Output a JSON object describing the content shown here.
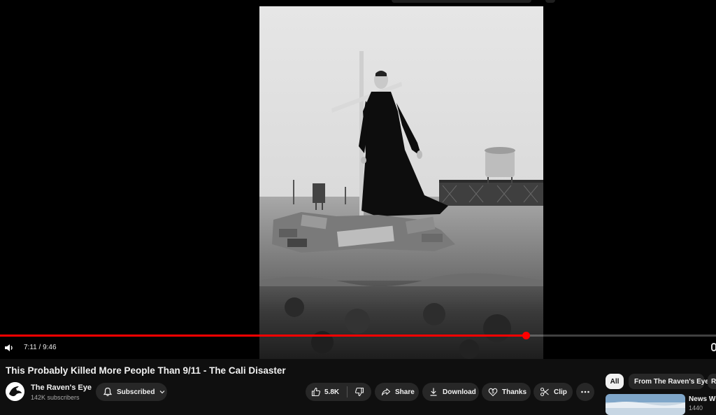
{
  "player": {
    "progress_fraction": 0.734,
    "time": {
      "current": "7:11",
      "separator": " / ",
      "duration": "9:46"
    },
    "colors": {
      "progress": "#ff0000",
      "background": "#000000"
    },
    "icons": {
      "volume": "volume-icon",
      "right_control": "toggle-icon"
    }
  },
  "video": {
    "title": "This Probably Killed More People Than 9/11 - The Cali Disaster"
  },
  "channel": {
    "name": "The Raven's Eye",
    "subscribers": "142K subscribers",
    "subscribe_label": "Subscribed"
  },
  "actions": {
    "like_count": "5.8K",
    "share": "Share",
    "download": "Download",
    "thanks": "Thanks",
    "clip": "Clip"
  },
  "sidebar": {
    "chips": [
      "All",
      "From The Raven's Eye",
      "R"
    ],
    "recommended": {
      "title": "News Wi",
      "meta": "1440"
    }
  },
  "theme": {
    "page_bg": "#0f0f0f",
    "button_bg": "#272727",
    "text": "#f1f1f1",
    "muted": "#aaaaaa"
  }
}
